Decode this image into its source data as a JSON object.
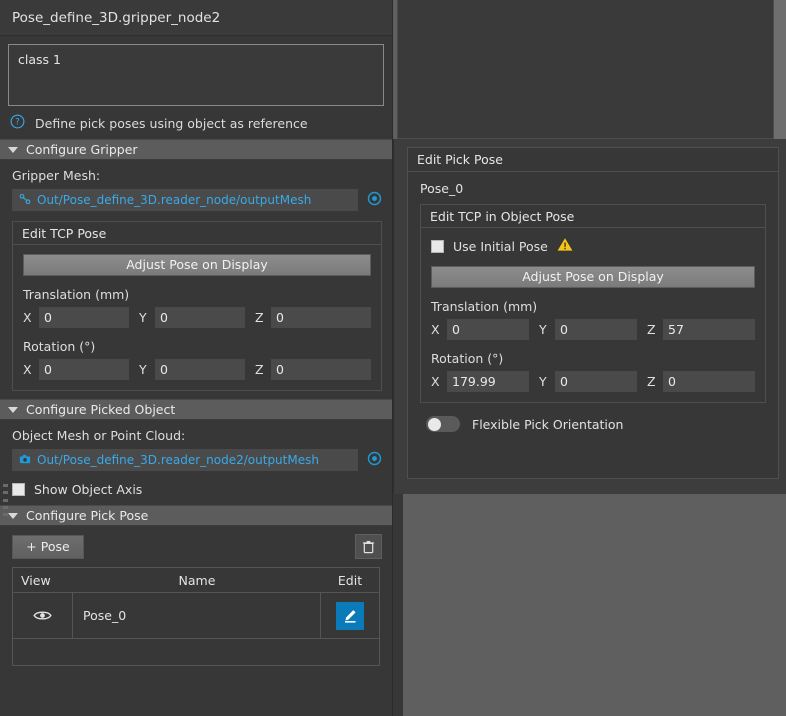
{
  "left_panel": {
    "node_title": "Pose_define_3D.gripper_node2",
    "class_box_value": "class 1",
    "hint": {
      "icon": "help-circle-icon",
      "text": "Define pick poses using object as reference"
    },
    "sections": {
      "configure_gripper": {
        "header": "Configure Gripper",
        "gripper_mesh_label": "Gripper Mesh:",
        "gripper_mesh_value": "Out/Pose_define_3D.reader_node/outputMesh",
        "gripper_mesh_icon": "node-link-icon",
        "target_icon": "target-icon",
        "tcp_group": {
          "title": "Edit TCP Pose",
          "adjust_button": "Adjust Pose on Display",
          "translation_label": "Translation (mm)",
          "translation": {
            "x": "0",
            "y": "0",
            "z": "0"
          },
          "rotation_label": "Rotation (°)",
          "rotation": {
            "x": "0",
            "y": "0",
            "z": "0"
          },
          "axis_x": "X",
          "axis_y": "Y",
          "axis_z": "Z"
        }
      },
      "configure_picked_object": {
        "header": "Configure Picked Object",
        "object_mesh_label": "Object Mesh or Point Cloud:",
        "object_mesh_value": "Out/Pose_define_3D.reader_node2/outputMesh",
        "object_mesh_icon": "camera-icon",
        "target_icon": "target-icon",
        "show_object_axis_label": "Show Object Axis",
        "show_object_axis_checked": false
      },
      "configure_pick_pose": {
        "header": "Configure Pick Pose",
        "add_pose_button": "+ Pose",
        "delete_icon": "trash-icon",
        "table": {
          "columns": [
            "View",
            "Name",
            "Edit"
          ],
          "rows": [
            {
              "view_icon": "eye-icon",
              "name": "Pose_0",
              "edit_icon": "pencil-icon"
            }
          ]
        }
      }
    }
  },
  "edit_pick_pose": {
    "title": "Edit Pick Pose",
    "pose_name": "Pose_0",
    "tcp_group": {
      "title": "Edit TCP in Object Pose",
      "use_initial_pose_label": "Use Initial Pose",
      "use_initial_pose_checked": false,
      "warning_icon": "warning-triangle-icon",
      "adjust_button": "Adjust Pose on Display",
      "translation_label": "Translation (mm)",
      "translation": {
        "x": "0",
        "y": "0",
        "z": "57"
      },
      "rotation_label": "Rotation (°)",
      "rotation": {
        "x": "179.99",
        "y": "0",
        "z": "0"
      },
      "axis_x": "X",
      "axis_y": "Y",
      "axis_z": "Z"
    },
    "flexible_pick_orientation_label": "Flexible Pick Orientation",
    "flexible_pick_orientation_on": false
  },
  "colors": {
    "accent_blue": "#3aa9e8",
    "edit_button_blue": "#0a7ab8",
    "warning_yellow": "#f5c518",
    "panel_bg": "#373737",
    "section_header_bg": "#5c5c5c",
    "input_bg": "#4a4a4a",
    "outer_bg": "#5f5f5f"
  }
}
